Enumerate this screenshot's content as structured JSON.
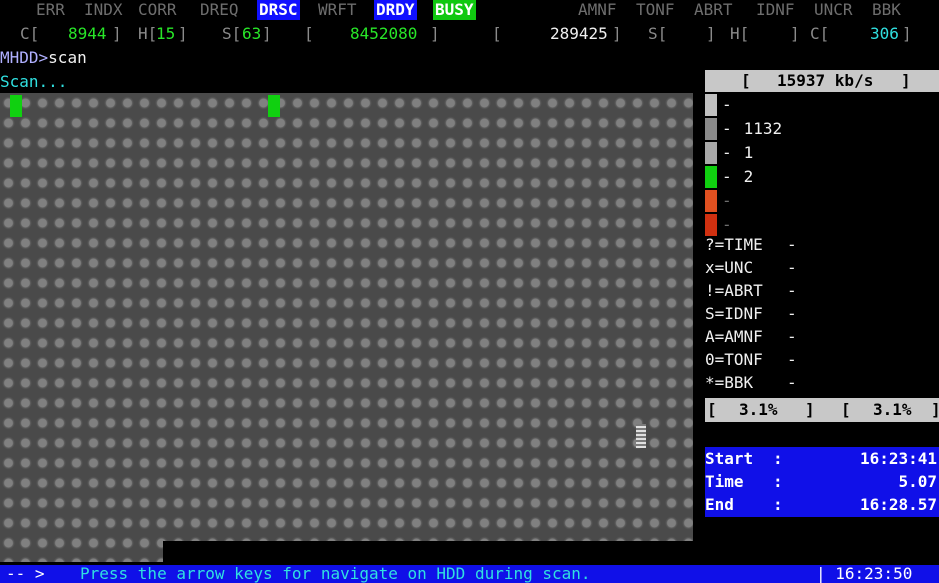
{
  "flags": [
    {
      "label": "ERR",
      "state": "off"
    },
    {
      "label": "INDX",
      "state": "off"
    },
    {
      "label": "CORR",
      "state": "off"
    },
    {
      "label": "DREQ",
      "state": "off"
    },
    {
      "label": "DRSC",
      "state": "blue"
    },
    {
      "label": "WRFT",
      "state": "off"
    },
    {
      "label": "DRDY",
      "state": "blue"
    },
    {
      "label": "BUSY",
      "state": "green"
    },
    {
      "label": "AMNF",
      "state": "off"
    },
    {
      "label": "TONF",
      "state": "off"
    },
    {
      "label": "ABRT",
      "state": "off"
    },
    {
      "label": "IDNF",
      "state": "off"
    },
    {
      "label": "UNCR",
      "state": "off"
    },
    {
      "label": "BBK",
      "state": "off"
    }
  ],
  "registers": {
    "c_label": "C[",
    "c_value": "8944",
    "c_close": "]",
    "h_label": "H[",
    "h_value": "15",
    "h_close": "]",
    "s_label": "S[",
    "s_value": "63",
    "s_close": "]",
    "lba_open": "[",
    "lba_value": "8452080",
    "lba_close": "]",
    "lba2_open": "[",
    "lba2_value": "289425",
    "lba2_close": "]",
    "s2": "S[",
    "s2_close": "]",
    "h2": "H[",
    "h2_close": "]",
    "c2": "C[",
    "c2_value": "306",
    "c2_close": "]"
  },
  "console": {
    "prompt": "MHDD>",
    "command": "scan",
    "status": "Scan..."
  },
  "speed": {
    "open": "[",
    "value": "15937 kb/s",
    "close": "]"
  },
  "legend": [
    {
      "color": "#c0c0c0",
      "count": "",
      "dim": false
    },
    {
      "color": "#8a8a8a",
      "count": "1132",
      "dim": false
    },
    {
      "color": "#a8a8a8",
      "count": "1",
      "dim": false
    },
    {
      "color": "#10d010",
      "count": "2",
      "dim": false
    },
    {
      "color": "#e05020",
      "count": "",
      "dim": true
    },
    {
      "color": "#d03010",
      "count": "",
      "dim": true
    }
  ],
  "errors": [
    {
      "code": "?",
      "name": "TIME"
    },
    {
      "code": "x",
      "name": "UNC"
    },
    {
      "code": "!",
      "name": "ABRT"
    },
    {
      "code": "S",
      "name": "IDNF"
    },
    {
      "code": "A",
      "name": "AMNF"
    },
    {
      "code": "0",
      "name": "TONF"
    },
    {
      "code": "*",
      "name": "BBK"
    }
  ],
  "error_dash": "-",
  "legend_dash": "-",
  "progress": {
    "left": "3.1%",
    "right": "3.1%"
  },
  "times": {
    "start_label": "Start",
    "start_value": "16:23:41",
    "time_label": "Time",
    "time_value": "5.07",
    "end_label": "End",
    "end_value": "16:28.57",
    "colon": ":"
  },
  "statusbar": {
    "arrow": "-- >",
    "message": "Press the arrow keys for navigate on HDD during scan.",
    "clock": "| 16:23:50"
  }
}
